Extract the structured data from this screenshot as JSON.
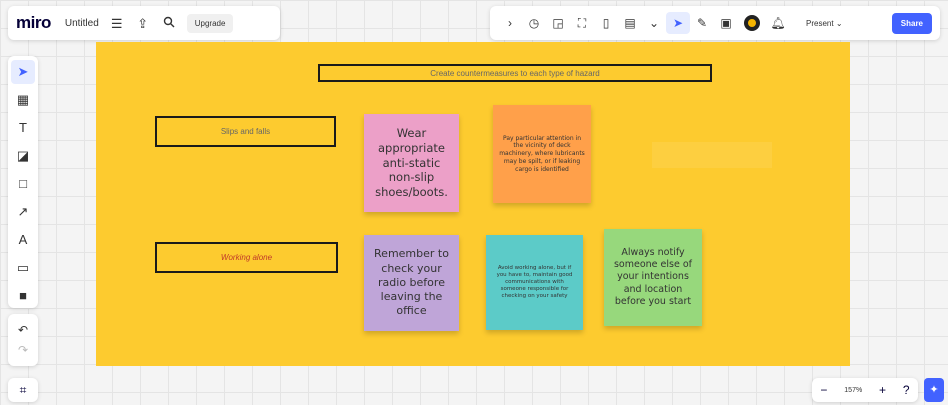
{
  "topbar": {
    "logo": "miro",
    "board_name": "Untitled",
    "menu_icon": "hamburger-menu-icon",
    "export_icon": "share-upload-icon",
    "search_icon": "search-icon",
    "upgrade_label": "Upgrade"
  },
  "collab_bar": {
    "icons": [
      "chevron-right-icon",
      "timer-icon",
      "card-icon",
      "focus-icon",
      "note-icon",
      "document-icon",
      "more-icon",
      "reactions-icon",
      "pen-icon",
      "comment-icon"
    ],
    "present_label": "Present",
    "present_chevron": "chevron-down-icon",
    "share_label": "Share"
  },
  "left_toolbar": {
    "tools": [
      "select-cursor-icon",
      "template-icon",
      "text-icon",
      "sticky-note-icon",
      "shape-icon",
      "connector-icon",
      "pen-icon",
      "comment-icon",
      "more-apps-icon"
    ],
    "undo_icon": "undo-icon",
    "redo_icon": "redo-icon",
    "frames_icon": "frames-icon"
  },
  "zoom": {
    "level": "157%",
    "minus_icon": "zoom-out-icon",
    "plus_icon": "zoom-in-icon",
    "help_icon": "help-icon",
    "add_icon": "add-sparkle-icon"
  },
  "board": {
    "frame_color": "#fdcb2f",
    "title": "Create countermeasures to each type of hazard",
    "hazards": {
      "slips": "Slips and falls",
      "alone": "Working alone"
    },
    "notes": {
      "wear": "Wear appropriate anti-static non-slip shoes/boots.",
      "deck": "Pay particular attention in the vicinity of deck machinery, where lubricants may be spilt, or if leaking cargo is identified",
      "radio": "Remember to check your radio before leaving the office",
      "avoid": "Avoid working alone, but if you have to, maintain good communications with someone responsible for checking on your safety",
      "notify": "Always notify someone else of your intentions and location before you start"
    }
  },
  "colors": {
    "accent": "#4262ff",
    "note_pink": "#eca0c8",
    "note_orange": "#ffa04a",
    "note_purple": "#bfa5d8",
    "note_teal": "#5ccbc8",
    "note_green": "#97d87c"
  }
}
